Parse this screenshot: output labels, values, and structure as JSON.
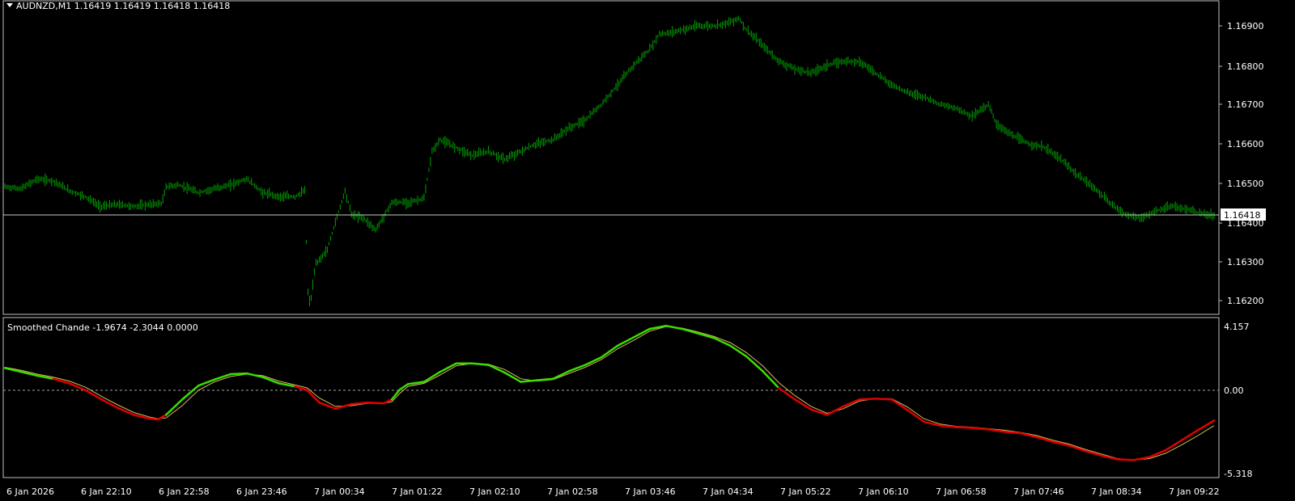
{
  "main_panel": {
    "title": "AUDNZD,M1  1.16419 1.16419 1.16418 1.16418",
    "current_price_label": "1.16418",
    "price_axis_labels": [
      "1.16900",
      "1.16800",
      "1.16700",
      "1.16600",
      "1.16500",
      "1.16400",
      "1.16300",
      "1.16200"
    ]
  },
  "indicator_panel": {
    "title": "Smoothed Chande -1.9674 -2.3044 0.0000",
    "axis_labels": [
      "4.157",
      "0.00",
      "-5.318"
    ]
  },
  "time_axis_labels": [
    "6 Jan 2026",
    "6 Jan 22:10",
    "6 Jan 22:58",
    "6 Jan 23:46",
    "7 Jan 00:34",
    "7 Jan 01:22",
    "7 Jan 02:10",
    "7 Jan 02:58",
    "7 Jan 03:46",
    "7 Jan 04:34",
    "7 Jan 05:22",
    "7 Jan 06:10",
    "7 Jan 06:58",
    "7 Jan 07:46",
    "7 Jan 08:34",
    "7 Jan 09:22"
  ],
  "colors": {
    "background": "#000000",
    "price_bars": "#00a000",
    "grid_axis": "#c0c0c0",
    "osc_up": "#3cdc00",
    "osc_down": "#e00000",
    "signal": "#d4c060",
    "zero_line": "#a0a0a0"
  },
  "chart_data": [
    {
      "type": "line",
      "title": "AUDNZD,M1  1.16419 1.16419 1.16418 1.16418",
      "ylim": [
        1.1617,
        1.1695
      ],
      "x": [
        0,
        20,
        40,
        60,
        80,
        100,
        118,
        140,
        160,
        180,
        195,
        200,
        215,
        240,
        260,
        280,
        300,
        320,
        340,
        360,
        372,
        376,
        379,
        385,
        400,
        410,
        422,
        430,
        445,
        460,
        480,
        500,
        520,
        530,
        540,
        560,
        580,
        600,
        620,
        640,
        660,
        680,
        700,
        720,
        740,
        760,
        780,
        800,
        812,
        820,
        840,
        860,
        880,
        900,
        910,
        920,
        940,
        960,
        980,
        1000,
        1020,
        1040,
        1060,
        1080,
        1100,
        1120,
        1140,
        1160,
        1180,
        1200,
        1220,
        1230,
        1250,
        1270,
        1290,
        1310,
        1330,
        1350,
        1370,
        1390,
        1410,
        1430,
        1450,
        1470,
        1490,
        1500
      ],
      "y": [
        1.1649,
        1.16485,
        1.1651,
        1.16505,
        1.1648,
        1.16465,
        1.1644,
        1.16445,
        1.1644,
        1.16445,
        1.16448,
        1.1649,
        1.16495,
        1.16475,
        1.16485,
        1.16495,
        1.1651,
        1.16475,
        1.16465,
        1.16465,
        1.1648,
        1.1622,
        1.1619,
        1.1629,
        1.1633,
        1.164,
        1.1648,
        1.1642,
        1.1641,
        1.1638,
        1.1645,
        1.1645,
        1.1646,
        1.1658,
        1.1661,
        1.1659,
        1.1657,
        1.1658,
        1.1656,
        1.1658,
        1.166,
        1.1661,
        1.1664,
        1.1666,
        1.167,
        1.1675,
        1.168,
        1.1684,
        1.1688,
        1.1688,
        1.1689,
        1.169,
        1.169,
        1.1691,
        1.1692,
        1.1689,
        1.1685,
        1.1681,
        1.1679,
        1.1678,
        1.168,
        1.1681,
        1.1681,
        1.1678,
        1.1675,
        1.1673,
        1.1672,
        1.167,
        1.1669,
        1.1667,
        1.167,
        1.1665,
        1.1662,
        1.166,
        1.1659,
        1.1656,
        1.1652,
        1.1649,
        1.1645,
        1.1642,
        1.1641,
        1.1643,
        1.1644,
        1.1643,
        1.16418,
        1.16418
      ]
    },
    {
      "type": "line",
      "title": "Smoothed Chande -1.9674 -2.3044 0.0000",
      "ylim": [
        -5.318,
        4.157
      ],
      "x": [
        0,
        20,
        40,
        60,
        80,
        100,
        120,
        140,
        160,
        180,
        190,
        200,
        220,
        240,
        260,
        280,
        300,
        320,
        340,
        360,
        375,
        390,
        410,
        430,
        450,
        470,
        480,
        490,
        500,
        520,
        540,
        560,
        580,
        600,
        620,
        640,
        660,
        680,
        700,
        720,
        740,
        760,
        780,
        800,
        820,
        840,
        860,
        880,
        900,
        920,
        940,
        960,
        980,
        1000,
        1020,
        1040,
        1060,
        1080,
        1100,
        1120,
        1140,
        1160,
        1180,
        1200,
        1220,
        1240,
        1260,
        1280,
        1300,
        1320,
        1340,
        1360,
        1380,
        1400,
        1420,
        1440,
        1460,
        1480,
        1500
      ],
      "series": [
        {
          "values": [
            1.45,
            1.2,
            0.95,
            0.75,
            0.45,
            0.0,
            -0.6,
            -1.15,
            -1.6,
            -1.85,
            -1.9,
            -1.6,
            -0.6,
            0.3,
            0.7,
            1.05,
            1.1,
            0.85,
            0.45,
            0.25,
            0.0,
            -0.8,
            -1.2,
            -0.9,
            -0.8,
            -0.85,
            -0.6,
            0.05,
            0.4,
            0.55,
            1.2,
            1.75,
            1.75,
            1.65,
            1.15,
            0.55,
            0.65,
            0.75,
            1.25,
            1.65,
            2.15,
            2.9,
            3.45,
            4.0,
            4.2,
            4.0,
            3.7,
            3.4,
            2.9,
            2.2,
            1.25,
            0.15,
            -0.6,
            -1.25,
            -1.6,
            -1.05,
            -0.6,
            -0.55,
            -0.6,
            -1.3,
            -2.05,
            -2.3,
            -2.4,
            -2.45,
            -2.55,
            -2.7,
            -2.8,
            -3.05,
            -3.35,
            -3.6,
            -3.95,
            -4.25,
            -4.5,
            -4.55,
            -4.35,
            -3.9,
            -3.25,
            -2.6,
            -1.97
          ],
          "up": [
            1,
            1,
            1,
            1,
            0,
            0,
            0,
            0,
            0,
            0,
            0,
            0,
            1,
            1,
            1,
            1,
            1,
            1,
            1,
            1,
            0,
            0,
            0,
            0,
            0,
            0,
            0,
            1,
            1,
            1,
            1,
            1,
            1,
            1,
            1,
            1,
            1,
            1,
            1,
            1,
            1,
            1,
            1,
            1,
            1,
            1,
            1,
            1,
            1,
            1,
            1,
            1,
            0,
            0,
            0,
            0,
            0,
            0,
            0,
            0,
            0,
            0,
            0,
            0,
            0,
            0,
            0,
            0,
            0,
            0,
            0,
            0,
            0,
            0,
            0,
            0,
            0,
            0,
            0
          ]
        },
        {
          "values": [
            1.5,
            1.3,
            1.05,
            0.85,
            0.6,
            0.2,
            -0.4,
            -0.95,
            -1.45,
            -1.75,
            -1.85,
            -1.8,
            -1.0,
            0.0,
            0.55,
            0.9,
            1.05,
            0.95,
            0.6,
            0.35,
            0.15,
            -0.5,
            -1.05,
            -1.0,
            -0.85,
            -0.85,
            -0.75,
            -0.2,
            0.25,
            0.45,
            1.0,
            1.6,
            1.75,
            1.7,
            1.35,
            0.75,
            0.6,
            0.7,
            1.1,
            1.5,
            2.0,
            2.7,
            3.25,
            3.85,
            4.15,
            4.05,
            3.8,
            3.5,
            3.1,
            2.45,
            1.6,
            0.5,
            -0.35,
            -1.05,
            -1.5,
            -1.2,
            -0.7,
            -0.55,
            -0.55,
            -1.1,
            -1.85,
            -2.2,
            -2.35,
            -2.4,
            -2.5,
            -2.6,
            -2.75,
            -2.95,
            -3.25,
            -3.5,
            -3.85,
            -4.15,
            -4.45,
            -4.55,
            -4.45,
            -4.1,
            -3.55,
            -2.95,
            -2.3
          ]
        }
      ]
    }
  ]
}
